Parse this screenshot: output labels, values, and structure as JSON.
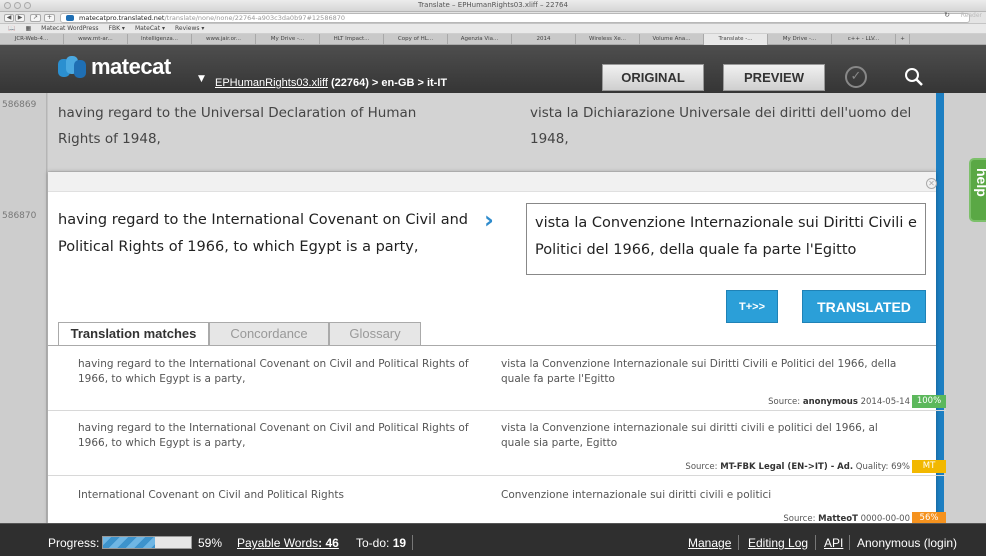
{
  "browser": {
    "window_title": "Translate – EPHumanRights03.xliff – 22764",
    "url_host": "matecatpro.translated.net",
    "url_path": "/translate/none/none/22764-a903c3da0b97#12586870",
    "reload_icon": "reload-icon",
    "reader_label": "Reader",
    "bookmarks": [
      "Matecat WordPress",
      "FBK ▾",
      "MateCat ▾",
      "Reviews ▾"
    ],
    "tabs": [
      "JCR-Web-4...",
      "www.mt-ar...",
      "Intelligenza...",
      "www.jair.or...",
      "My Drive -...",
      "HLT Impact...",
      "Copy of HL...",
      "Agenzia Via...",
      "2014",
      "Wireless Xe...",
      "Volume Ana...",
      "Translate -...",
      "My Drive -...",
      "c++ - LLV..."
    ],
    "active_tab_index": 11
  },
  "header": {
    "logo_text": "matecat",
    "file_name": "EPHumanRights03.xliff",
    "file_meta": " (22764) > en-GB > it-IT",
    "original_label": "ORIGINAL",
    "preview_label": "PREVIEW",
    "icons": [
      "check-circle-icon",
      "search-icon"
    ]
  },
  "segments": {
    "prev": {
      "id": "586869",
      "source": "having regard to the Universal Declaration of Human Rights of 1948,",
      "target": "vista la Dichiarazione Universale dei diritti dell'uomo del 1948,"
    },
    "active": {
      "id": "586870",
      "source": "having regard to the International Covenant on Civil and Political Rights of 1966, to which Egypt is a party,",
      "target": "vista la Convenzione Internazionale sui Diritti Civili e Politici del 1966, della quale fa parte l'Egitto",
      "tplus_label": "T+>>",
      "translated_label": "TRANSLATED"
    }
  },
  "help_label": "help",
  "tm_tabs": [
    "Translation matches",
    "Concordance",
    "Glossary"
  ],
  "matches": [
    {
      "source": "having regard to the International Covenant on Civil and Political Rights of 1966, to which Egypt is a party,",
      "target": "vista la Convenzione Internazionale sui Diritti Civili e Politici del 1966, della quale fa parte l'Egitto",
      "source_label": "Source: ",
      "source_name": "anonymous",
      "extra": "  2014-05-14",
      "badge": "100%",
      "badge_color": "#5cb85c"
    },
    {
      "source": "having regard to the International Covenant on Civil and Political Rights of 1966, to which Egypt is a party,",
      "target": "vista la Convenzione internazionale sui diritti civili e politici del 1966, al quale sia parte, Egitto",
      "source_label": "Source: ",
      "source_name": "MT-FBK Legal (EN->IT) - Ad.",
      "extra": "  Quality: 69%",
      "badge": "MT",
      "badge_color": "#f2b800"
    },
    {
      "source": "International Covenant on Civil and Political Rights",
      "target": "Convenzione internazionale sui diritti civili e politici",
      "source_label": "Source: ",
      "source_name": "MatteoT",
      "extra": "  0000-00-00",
      "badge": "56%",
      "badge_color": "#f5921e"
    }
  ],
  "footer": {
    "progress_label": "Progress:",
    "progress_value": 0.59,
    "progress_text": "59%",
    "payable_label": "Payable Words",
    "payable_value": ": 46",
    "todo_label": "To-do: ",
    "todo_value": "19",
    "links": [
      "Manage",
      "Editing Log",
      "API",
      "Anonymous (login)"
    ]
  },
  "colors": {
    "accent": "#2b9fd8",
    "header_bg": "#404040",
    "help_green": "#5aa845"
  }
}
